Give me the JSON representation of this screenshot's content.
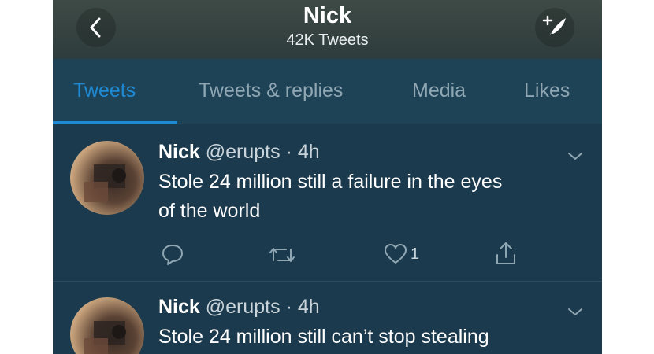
{
  "profile": {
    "name": "Nick",
    "tweet_count": "42K Tweets"
  },
  "tabs": [
    {
      "label": "Tweets",
      "active": true
    },
    {
      "label": "Tweets & replies",
      "active": false
    },
    {
      "label": "Media",
      "active": false
    },
    {
      "label": "Likes",
      "active": false
    }
  ],
  "tweets": [
    {
      "name": "Nick",
      "handle": "@erupts",
      "time": "· 4h",
      "lines": [
        "Stole 24 million still a failure in the eyes",
        "of the world"
      ],
      "likes": "1"
    },
    {
      "name": "Nick",
      "handle": "@erupts",
      "time": "· 4h",
      "lines": [
        "Stole 24 million still can’t stop stealing"
      ]
    }
  ],
  "colors": {
    "accent": "#1f8ad4",
    "background": "#1c3a4d",
    "header": "#3e4a45"
  },
  "icons": [
    "back-arrow-icon",
    "compose-tweet-icon",
    "reply-icon",
    "retweet-icon",
    "like-icon",
    "share-icon",
    "chevron-down-icon"
  ]
}
